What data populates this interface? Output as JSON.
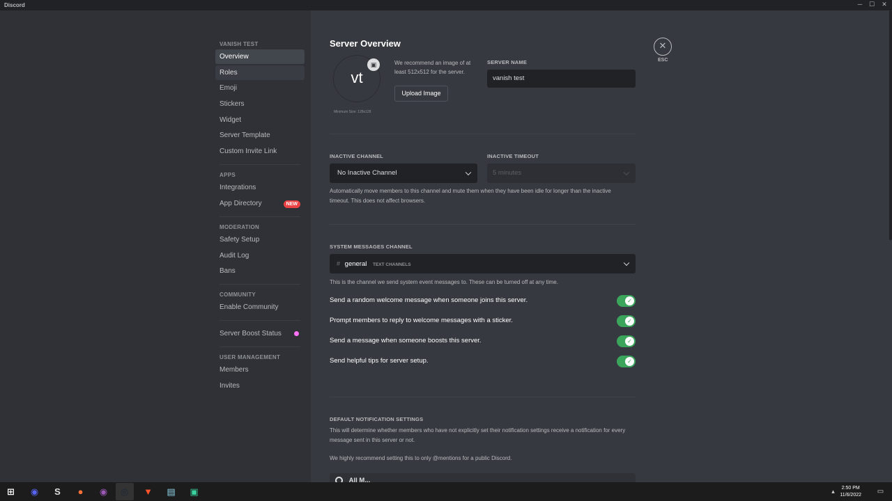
{
  "window": {
    "title": "Discord",
    "controls": [
      "─",
      "☐",
      "✕"
    ]
  },
  "sidebar": {
    "groups": [
      {
        "header": "VANISH TEST",
        "items": [
          {
            "label": "Overview",
            "state": "active"
          },
          {
            "label": "Roles",
            "state": "hover"
          },
          {
            "label": "Emoji"
          },
          {
            "label": "Stickers"
          },
          {
            "label": "Widget"
          },
          {
            "label": "Server Template"
          },
          {
            "label": "Custom Invite Link"
          }
        ]
      },
      {
        "header": "APPS",
        "items": [
          {
            "label": "Integrations"
          },
          {
            "label": "App Directory",
            "badge": "NEW"
          }
        ]
      },
      {
        "header": "MODERATION",
        "items": [
          {
            "label": "Safety Setup"
          },
          {
            "label": "Audit Log"
          },
          {
            "label": "Bans"
          }
        ]
      },
      {
        "header": "COMMUNITY",
        "items": [
          {
            "label": "Enable Community"
          }
        ]
      },
      {
        "header": "",
        "items": [
          {
            "label": "Server Boost Status",
            "dot": true
          }
        ]
      },
      {
        "header": "USER MANAGEMENT",
        "items": [
          {
            "label": "Members"
          },
          {
            "label": "Invites"
          }
        ]
      }
    ]
  },
  "main": {
    "title": "Server Overview",
    "avatar": {
      "initials": "vt",
      "min_size": "Minimum Size: 128x128",
      "recommend": "We recommend an image of at least 512x512 for the server.",
      "upload_label": "Upload Image"
    },
    "server_name": {
      "label": "SERVER NAME",
      "value": "vanish test"
    },
    "inactive_channel": {
      "label": "INACTIVE CHANNEL",
      "value": "No Inactive Channel"
    },
    "inactive_timeout": {
      "label": "INACTIVE TIMEOUT",
      "value": "5 minutes"
    },
    "inactive_help": "Automatically move members to this channel and mute them when they have been idle for longer than the inactive timeout. This does not affect browsers.",
    "system_channel": {
      "label": "SYSTEM MESSAGES CHANNEL",
      "hash": "#",
      "name": "general",
      "category": "TEXT CHANNELS",
      "help": "This is the channel we send system event messages to. These can be turned off at any time."
    },
    "toggles": [
      {
        "label": "Send a random welcome message when someone joins this server.",
        "on": true
      },
      {
        "label": "Prompt members to reply to welcome messages with a sticker.",
        "on": true
      },
      {
        "label": "Send a message when someone boosts this server.",
        "on": true
      },
      {
        "label": "Send helpful tips for server setup.",
        "on": true
      }
    ],
    "notifications": {
      "label": "DEFAULT NOTIFICATION SETTINGS",
      "help1": "This will determine whether members who have not explicitly set their notification settings receive a notification for every message sent in this server or not.",
      "help2": "We highly recommend setting this to only @mentions for a public Discord.",
      "first_option": "All M..."
    },
    "close": {
      "icon": "✕",
      "label": "ESC"
    }
  },
  "taskbar": {
    "icons": [
      {
        "name": "windows-start-icon",
        "glyph": "⊞",
        "color": "#ffffff"
      },
      {
        "name": "discord-icon",
        "glyph": "◉",
        "color": "#5865f2"
      },
      {
        "name": "s-app-icon",
        "glyph": "S",
        "color": "#e0e0e0"
      },
      {
        "name": "firefox-icon",
        "glyph": "●",
        "color": "#ff7139"
      },
      {
        "name": "discord-alt-icon",
        "glyph": "◉",
        "color": "#9b59b6"
      },
      {
        "name": "steam-icon",
        "glyph": "◎",
        "color": "#1b2838"
      },
      {
        "name": "brave-icon",
        "glyph": "▼",
        "color": "#fb542b"
      },
      {
        "name": "notes-icon",
        "glyph": "▤",
        "color": "#8fd3e8"
      },
      {
        "name": "app-icon",
        "glyph": "▣",
        "color": "#3ad29f"
      }
    ],
    "time": "2:50 PM",
    "date": "11/6/2022"
  }
}
